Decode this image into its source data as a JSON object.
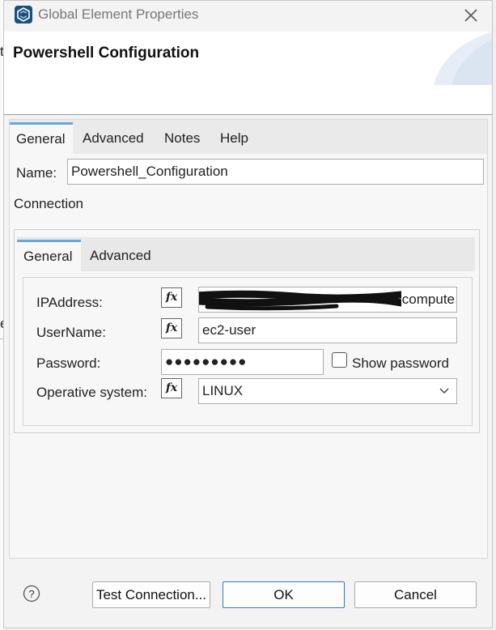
{
  "background": {
    "left_chars": [
      "t",
      "e"
    ]
  },
  "window": {
    "title": "Global Element Properties",
    "icons": {
      "app": "app-logo-icon",
      "close": "close-icon"
    }
  },
  "header": {
    "title": "Powershell Configuration"
  },
  "tabs": [
    "General",
    "Advanced",
    "Notes",
    "Help"
  ],
  "name_field": {
    "label": "Name:",
    "value": "Powershell_Configuration"
  },
  "connection": {
    "label": "Connection",
    "tabs": [
      "General",
      "Advanced"
    ],
    "fields": {
      "ipaddress": {
        "label": "IPAddress:",
        "value_suffix": "compute",
        "redacted": true
      },
      "username": {
        "label": "UserName:",
        "value": "ec2-user"
      },
      "password": {
        "label": "Password:",
        "value": "●●●●●●●●●",
        "show_password_label": "Show password",
        "show_password_checked": false
      },
      "os": {
        "label": "Operative system:",
        "value": "LINUX"
      }
    },
    "fx_label": "fx"
  },
  "footer": {
    "test_connection": "Test Connection...",
    "ok": "OK",
    "cancel": "Cancel",
    "help_symbol": "?"
  },
  "colors": {
    "active_tab_accent": "#6aa8d6",
    "default_button_border": "#3c78b4"
  }
}
